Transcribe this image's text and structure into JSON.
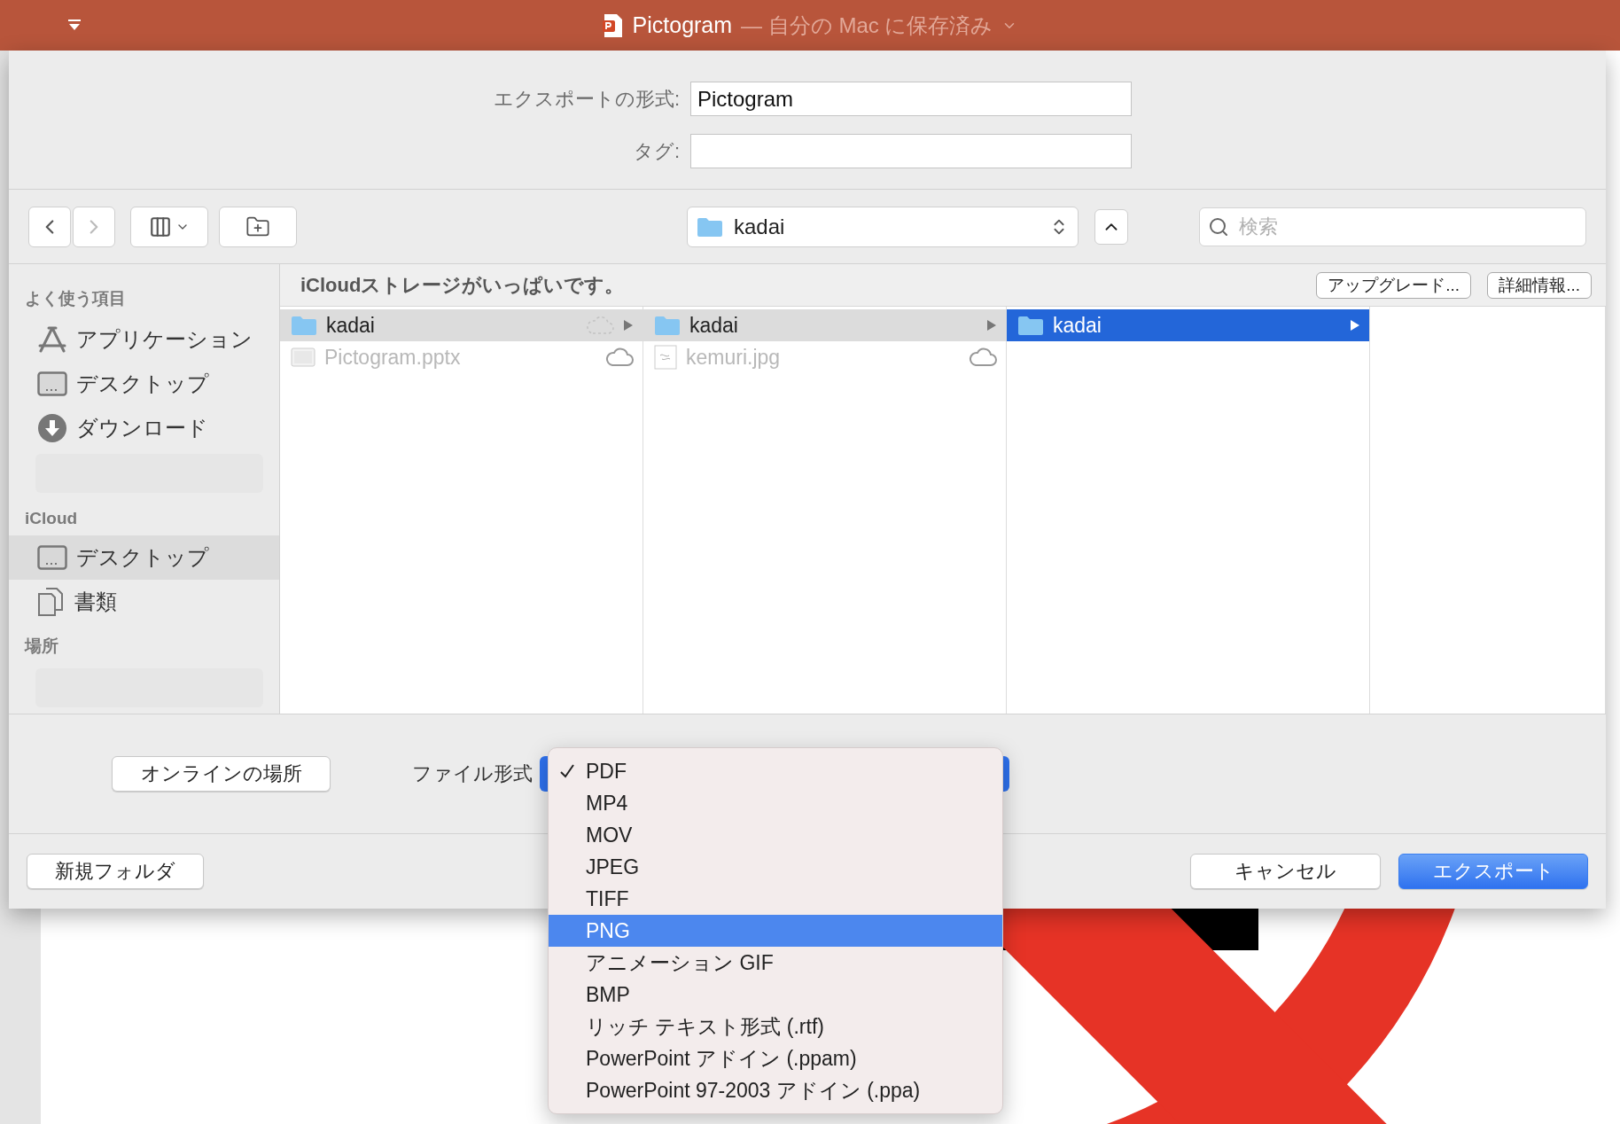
{
  "title_bar": {
    "document": "Pictogram",
    "status": "— 自分の Mac に保存済み"
  },
  "export_form": {
    "fields": [
      {
        "label": "エクスポートの形式:",
        "value": "Pictogram"
      },
      {
        "label": "タグ:"
      }
    ]
  },
  "toolbar": {
    "back_disabled": false,
    "forward_disabled": true,
    "location": "kadai",
    "search_placeholder": "検索"
  },
  "sidebar": {
    "sections": [
      {
        "title": "よく使う項目",
        "items": [
          {
            "kind": "applications",
            "label": "アプリケーション",
            "selected": false
          },
          {
            "kind": "desktop",
            "label": "デスクトップ",
            "selected": false
          },
          {
            "kind": "downloads",
            "label": "ダウンロード",
            "selected": false
          },
          {
            "kind": "blurred",
            "selected": false
          }
        ]
      },
      {
        "title": "iCloud",
        "items": [
          {
            "kind": "desktop",
            "label": "デスクトップ",
            "selected": true
          },
          {
            "kind": "documents",
            "label": "書類",
            "selected": false
          }
        ]
      },
      {
        "title": "場所",
        "items": [
          {
            "kind": "blurred",
            "selected": false
          }
        ]
      }
    ]
  },
  "banner": {
    "message": "iCloudストレージがいっぱいです。",
    "buttons": [
      "アップグレード...",
      "詳細情報..."
    ]
  },
  "columns": [
    {
      "focused": false,
      "rows": [
        {
          "kind": "folder",
          "name": "kadai",
          "selected": true,
          "in_cloud": true,
          "upload_pending": true
        },
        {
          "kind": "presentation",
          "name": "Pictogram.pptx",
          "selected": false,
          "in_cloud": true,
          "upload_pending": false
        }
      ]
    },
    {
      "focused": false,
      "rows": [
        {
          "kind": "folder",
          "name": "kadai",
          "selected": true,
          "in_cloud": false
        },
        {
          "kind": "image",
          "name": "kemuri.jpg",
          "selected": false,
          "in_cloud": true,
          "upload_pending": false
        }
      ]
    },
    {
      "focused": true,
      "rows": [
        {
          "kind": "folder",
          "name": "kadai",
          "selected": true,
          "in_cloud": false
        }
      ]
    }
  ],
  "options": {
    "online_button": "オンラインの場所",
    "format_label": "ファイル形式"
  },
  "format_menu": [
    {
      "label": "PDF",
      "checked": true,
      "highlighted": false
    },
    {
      "label": "MP4",
      "checked": false,
      "highlighted": false
    },
    {
      "label": "MOV",
      "checked": false,
      "highlighted": false
    },
    {
      "label": "JPEG",
      "checked": false,
      "highlighted": false
    },
    {
      "label": "TIFF",
      "checked": false,
      "highlighted": false
    },
    {
      "label": "PNG",
      "checked": false,
      "highlighted": true
    },
    {
      "label": "アニメーション GIF",
      "checked": false,
      "highlighted": false
    },
    {
      "label": "BMP",
      "checked": false,
      "highlighted": false
    },
    {
      "label": "リッチ テキスト形式 (.rtf)",
      "checked": false,
      "highlighted": false
    },
    {
      "label": "PowerPoint アドイン (.ppam)",
      "checked": false,
      "highlighted": false
    },
    {
      "label": "PowerPoint 97-2003 アドイン (.ppa)",
      "checked": false,
      "highlighted": false
    }
  ],
  "buttons": {
    "new_folder": "新規フォルダ",
    "cancel": "キャンセル",
    "export": "エクスポート"
  }
}
